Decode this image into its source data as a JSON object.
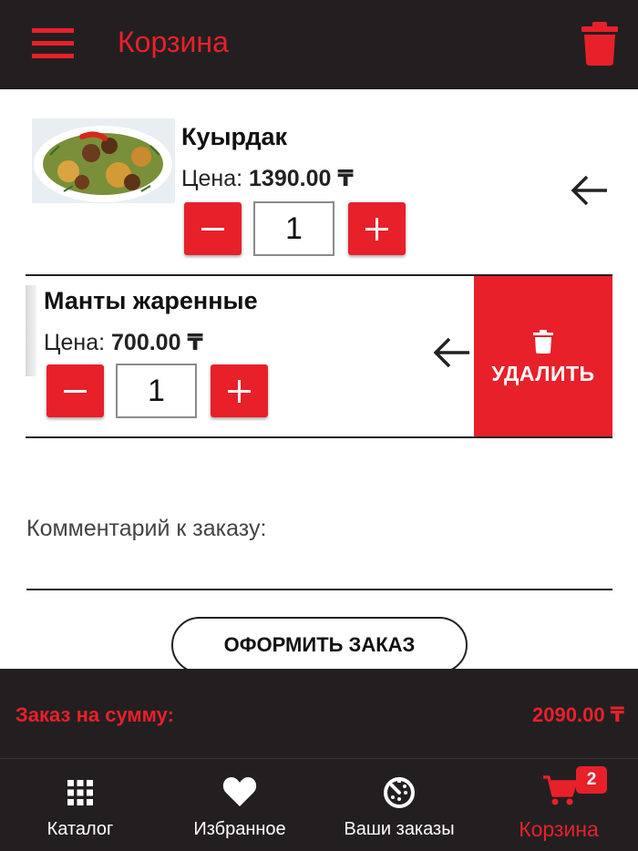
{
  "header": {
    "title": "Корзина",
    "menu_icon": "hamburger-menu-icon",
    "clear_icon": "trash-icon"
  },
  "cart": {
    "items": [
      {
        "name": "Куырдак",
        "price_label": "Цена:",
        "price": "1390.00 ₸",
        "quantity": "1"
      },
      {
        "name": "Манты жаренные",
        "price_label": "Цена:",
        "price": "700.00 ₸",
        "quantity": "1",
        "delete_label": "УДАЛИТЬ"
      }
    ]
  },
  "comment": {
    "label": "Комментарий к заказу:",
    "value": ""
  },
  "checkout": {
    "label": "ОФОРМИТЬ ЗАКАЗ"
  },
  "total": {
    "label": "Заказ на сумму:",
    "value": "2090.00 ₸"
  },
  "nav": {
    "items": [
      {
        "label": "Каталог",
        "icon": "grid-icon",
        "active": false
      },
      {
        "label": "Избранное",
        "icon": "heart-icon",
        "active": false
      },
      {
        "label": "Ваши заказы",
        "icon": "timer-icon",
        "active": false
      },
      {
        "label": "Корзина",
        "icon": "cart-icon",
        "active": true
      }
    ],
    "cart_badge": "2"
  },
  "colors": {
    "brand_red": "#e8202a",
    "dark_bar": "#231f20",
    "background": "#ffffff"
  }
}
